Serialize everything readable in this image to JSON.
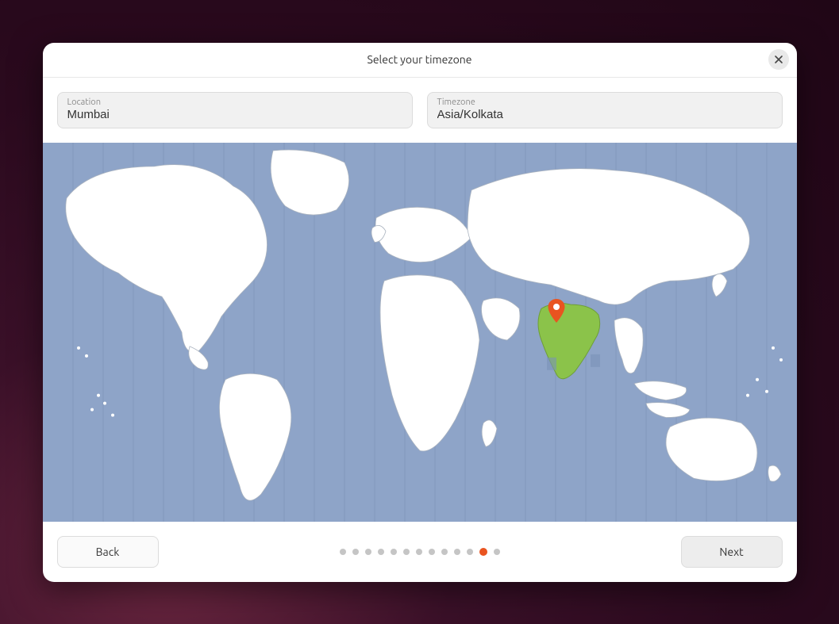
{
  "title": "Select your timezone",
  "fields": {
    "location": {
      "label": "Location",
      "value": "Mumbai"
    },
    "timezone": {
      "label": "Timezone",
      "value": "Asia/Kolkata"
    }
  },
  "map": {
    "selected_region": "India",
    "pin": {
      "left_pct": 68.2,
      "top_pct": 47.5
    },
    "highlight_color": "#8bc34a",
    "ocean_color": "#8ea4c8",
    "land_color": "#ffffff",
    "pin_color": "#e95420"
  },
  "progress": {
    "total": 13,
    "active_index": 11
  },
  "buttons": {
    "back": "Back",
    "next": "Next"
  }
}
